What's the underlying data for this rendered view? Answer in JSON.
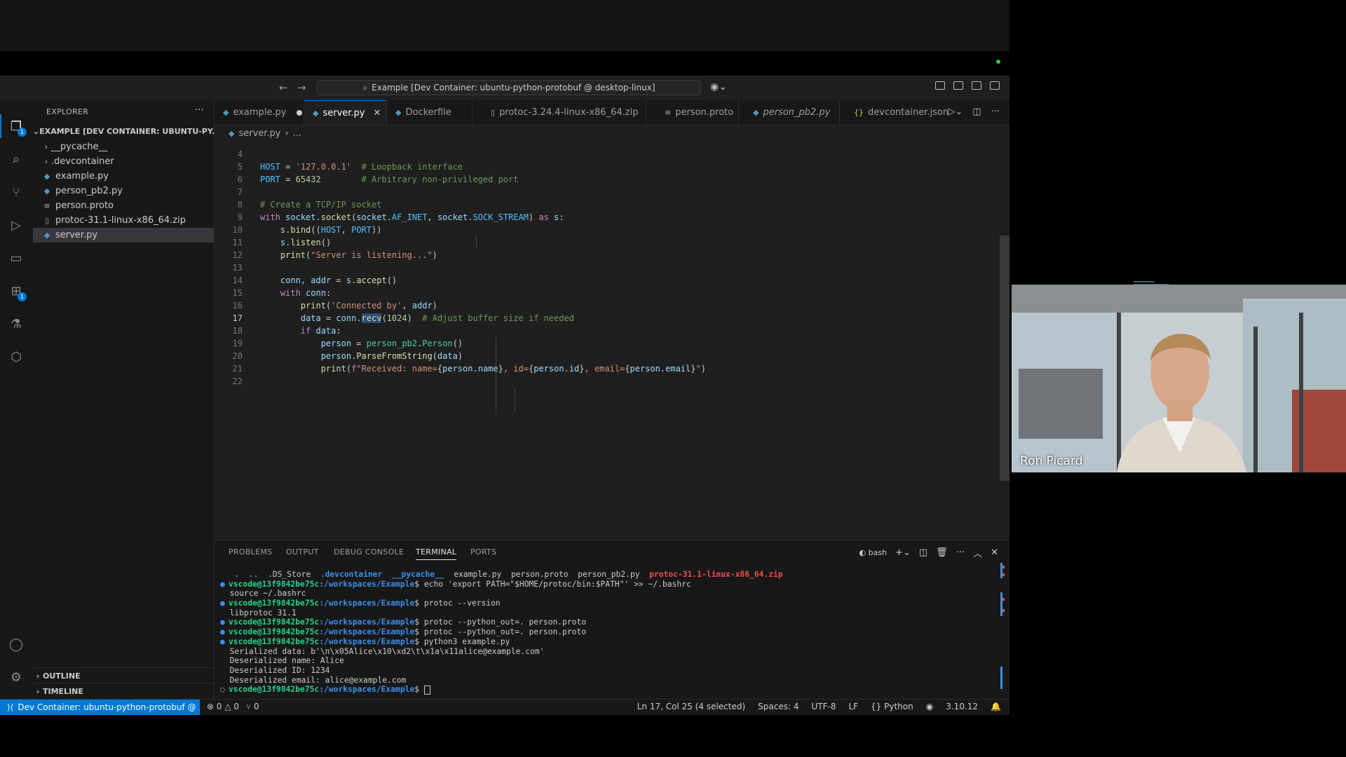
{
  "window": {
    "title": "Example [Dev Container: ubuntu-python-protobuf @ desktop-linux]"
  },
  "sidebar": {
    "title": "EXPLORER",
    "root": "EXAMPLE [DEV CONTAINER: UBUNTU-PY...",
    "items": [
      {
        "label": "__pycache__",
        "type": "folder"
      },
      {
        "label": ".devcontainer",
        "type": "folder"
      },
      {
        "label": "example.py",
        "type": "py"
      },
      {
        "label": "person_pb2.py",
        "type": "py"
      },
      {
        "label": "person.proto",
        "type": "proto"
      },
      {
        "label": "protoc-31.1-linux-x86_64.zip",
        "type": "zip"
      },
      {
        "label": "server.py",
        "type": "py",
        "selected": true
      }
    ],
    "outline": "OUTLINE",
    "timeline": "TIMELINE"
  },
  "tabs": [
    {
      "label": "example.py",
      "modified": true
    },
    {
      "label": "server.py",
      "active": true
    },
    {
      "label": "Dockerfile"
    },
    {
      "label": "protoc-3.24.4-linux-x86_64.zip"
    },
    {
      "label": "person.proto"
    },
    {
      "label": "person_pb2.py"
    },
    {
      "label": "devcontainer.json"
    }
  ],
  "breadcrumb": {
    "file": "server.py",
    "rest": "..."
  },
  "editor": {
    "line_numbers": [
      "4",
      "5",
      "6",
      "7",
      "8",
      "9",
      "10",
      "11",
      "12",
      "13",
      "14",
      "15",
      "16",
      "17",
      "18",
      "19",
      "20",
      "21",
      "22"
    ],
    "current_line": "17"
  },
  "panel": {
    "tabs": [
      "PROBLEMS",
      "OUTPUT",
      "DEBUG CONSOLE",
      "TERMINAL",
      "PORTS"
    ],
    "active_tab": "TERMINAL",
    "shell": "bash",
    "ls": {
      "dots": ".  ..",
      "ds_store": ".DS_Store",
      "devcontainer": ".devcontainer",
      "pycache": "__pycache__",
      "files": "example.py  person.proto  person_pb2.py",
      "zip": "protoc-31.1-linux-x86_64.zip"
    },
    "prompt_user": "vscode@13f9842be75c",
    "prompt_path": ":/workspaces/Example",
    "commands": [
      "echo 'export PATH=\"$HOME/protoc/bin:$PATH\"' >> ~/.bashrc",
      "protoc --version",
      "protoc --python_out=. person.proto",
      "protoc --python_out=. person.proto",
      "python3 example.py"
    ],
    "outputs": {
      "source": "source ~/.bashrc",
      "version": "libprotoc 31.1",
      "serialized": "Serialized data: b'\\n\\x05Alice\\x10\\xd2\\t\\x1a\\x11alice@example.com'",
      "name": "Deserialized name: Alice",
      "id": "Deserialized ID: 1234",
      "email": "Deserialized email: alice@example.com"
    }
  },
  "status": {
    "remote": "Dev Container: ubuntu-python-protobuf @ ...",
    "errors": "0",
    "warnings": "0",
    "ports": "0",
    "cursor": "Ln 17, Col 25 (4 selected)",
    "spaces": "Spaces: 4",
    "encoding": "UTF-8",
    "eol": "LF",
    "language": "Python",
    "python_version": "3.10.12"
  },
  "video": {
    "participant": "Ron Picard"
  }
}
